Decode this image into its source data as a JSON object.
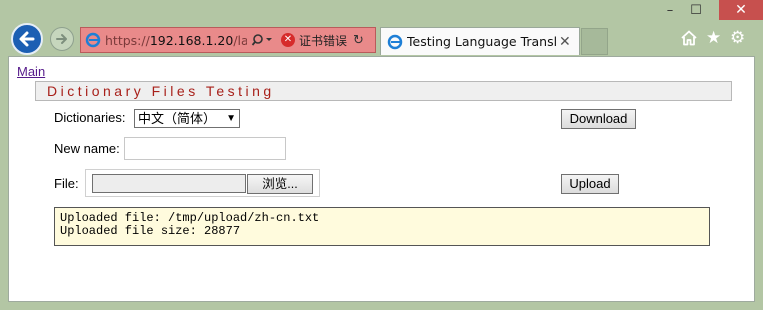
{
  "window": {
    "minimize": "–",
    "maximize": "☐",
    "close": "✕"
  },
  "address_bar": {
    "url_prefix": "https://",
    "url_host": "192.168.1.20",
    "url_rest": "/lang",
    "cert_error": "证书错误"
  },
  "tab": {
    "title": "Testing Language Transl...",
    "close": "✕"
  },
  "page": {
    "main_link": "Main",
    "section_title": "Dictionary Files Testing",
    "dictionaries_label": "Dictionaries:",
    "dictionary_selected": "中文（简体）",
    "download_button": "Download",
    "new_name_label": "New name:",
    "new_name_value": "",
    "file_label": "File:",
    "browse_button": "浏览...",
    "upload_button": "Upload",
    "log_lines": [
      "Uploaded file: /tmp/upload/zh-cn.txt",
      "Uploaded file size: 28877"
    ]
  }
}
